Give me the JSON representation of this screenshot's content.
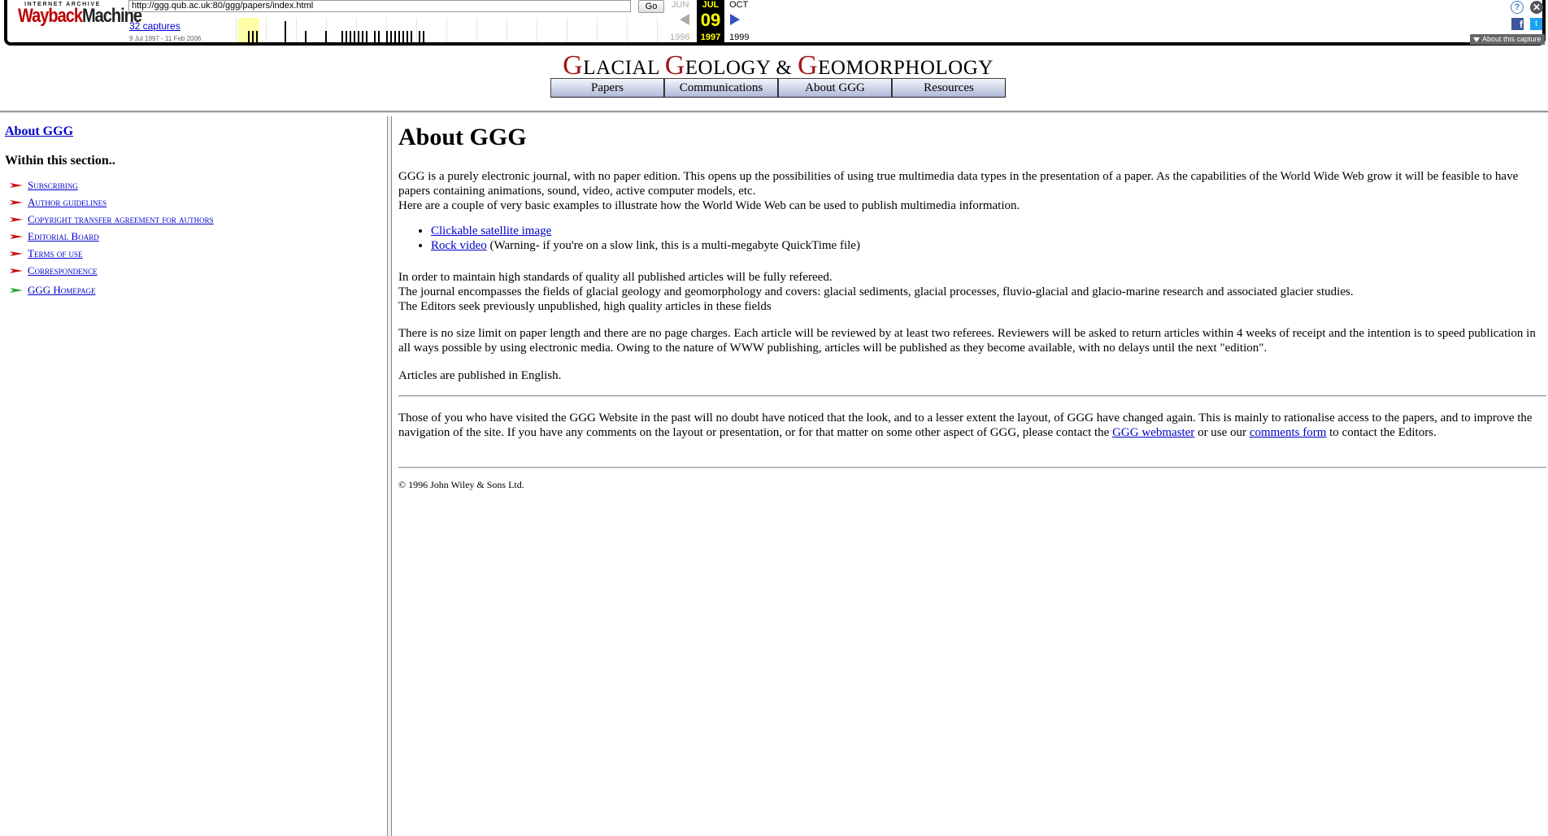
{
  "wayback": {
    "logo_top": "INTERNET ARCHIVE",
    "logo_main_a": "Wayback",
    "logo_main_b": "Machine",
    "url": "http://ggg.qub.ac.uk:80/ggg/papers/index.html",
    "go_label": "Go",
    "captures": "32 captures",
    "date_range": "9 Jul 1997 - 11 Feb 2006",
    "prev_month": "JUN",
    "current_month": "JUL",
    "next_month": "OCT",
    "day": "09",
    "prev_year": "1996",
    "current_year": "1997",
    "next_year": "1999",
    "help_icon": "?",
    "close_icon": "✕",
    "facebook_icon": "f",
    "twitter_icon": "t",
    "about_capture": "About this capture"
  },
  "site": {
    "title_parts": [
      "G",
      "LACIAL ",
      "G",
      "EOLOGY & ",
      "G",
      "EOMORPHOLOGY"
    ],
    "nav": [
      "Papers",
      "Communications",
      "About GGG",
      "Resources"
    ]
  },
  "leftnav": {
    "title": "About GGG",
    "subtitle": "Within this section..",
    "items": [
      {
        "label": "Subscribing",
        "arrow": "red"
      },
      {
        "label": "Author guidelines",
        "arrow": "red"
      },
      {
        "label": "Copyright transfer agreement for authors",
        "arrow": "red"
      },
      {
        "label": "Editorial Board",
        "arrow": "red"
      },
      {
        "label": "Terms of use",
        "arrow": "red"
      },
      {
        "label": "Correspondence",
        "arrow": "red"
      },
      {
        "label": "GGG Homepage",
        "arrow": "green"
      }
    ]
  },
  "main": {
    "heading": "About GGG",
    "intro_1": "GGG is a purely electronic journal, with no paper edition. This opens up the possibilities of using true multimedia data types in the presentation of a paper. As the capabilities of the World Wide Web grow it will be feasible to have papers containing animations, sound, video, active computer models, etc.",
    "intro_2": "Here are a couple of very basic examples to illustrate how the World Wide Web can be used to publish multimedia information.",
    "link_satellite": "Clickable satellite image",
    "link_rock": "Rock video",
    "rock_note": " (Warning- if you're on a slow link, this is a multi-megabyte QuickTime file)",
    "policy_1": "In order to maintain high standards of quality all published articles will be fully refereed.",
    "policy_2": "The journal encompasses the fields of glacial geology and geomorphology and covers: glacial sediments, glacial processes, fluvio-glacial and glacio-marine research and associated glacier studies.",
    "policy_3": "The Editors seek previously unpublished, high quality articles in these fields",
    "charges": "There is no size limit on paper length and there are no page charges. Each article will be reviewed by at least two referees. Reviewers will be asked to return articles within 4 weeks of receipt and the intention is to speed publication in all ways possible by using electronic media. Owing to the nature of WWW publishing, articles will be published as they become available, with no delays until the next \"edition\".",
    "language": "Articles are published in English.",
    "changes_1": "Those of you who have visited the GGG Website in the past will no doubt have noticed that the look, and to a lesser extent the layout, of GGG have changed again. This is mainly to rationalise access to the papers, and to improve the navigation of the site. If you have any comments on the layout or presentation, or for that matter on some other aspect of GGG, please contact the ",
    "link_webmaster": "GGG webmaster",
    "changes_2": " or use our ",
    "link_comments": "comments form",
    "changes_3": " to contact the Editors.",
    "copyright": "© 1996 John Wiley & Sons Ltd."
  },
  "colors": {
    "title_caps": "#a11818",
    "link": "#0000cc",
    "wayback_current": "#ffff00",
    "arrow_red": "#cc1111",
    "arrow_green": "#22aa33"
  }
}
